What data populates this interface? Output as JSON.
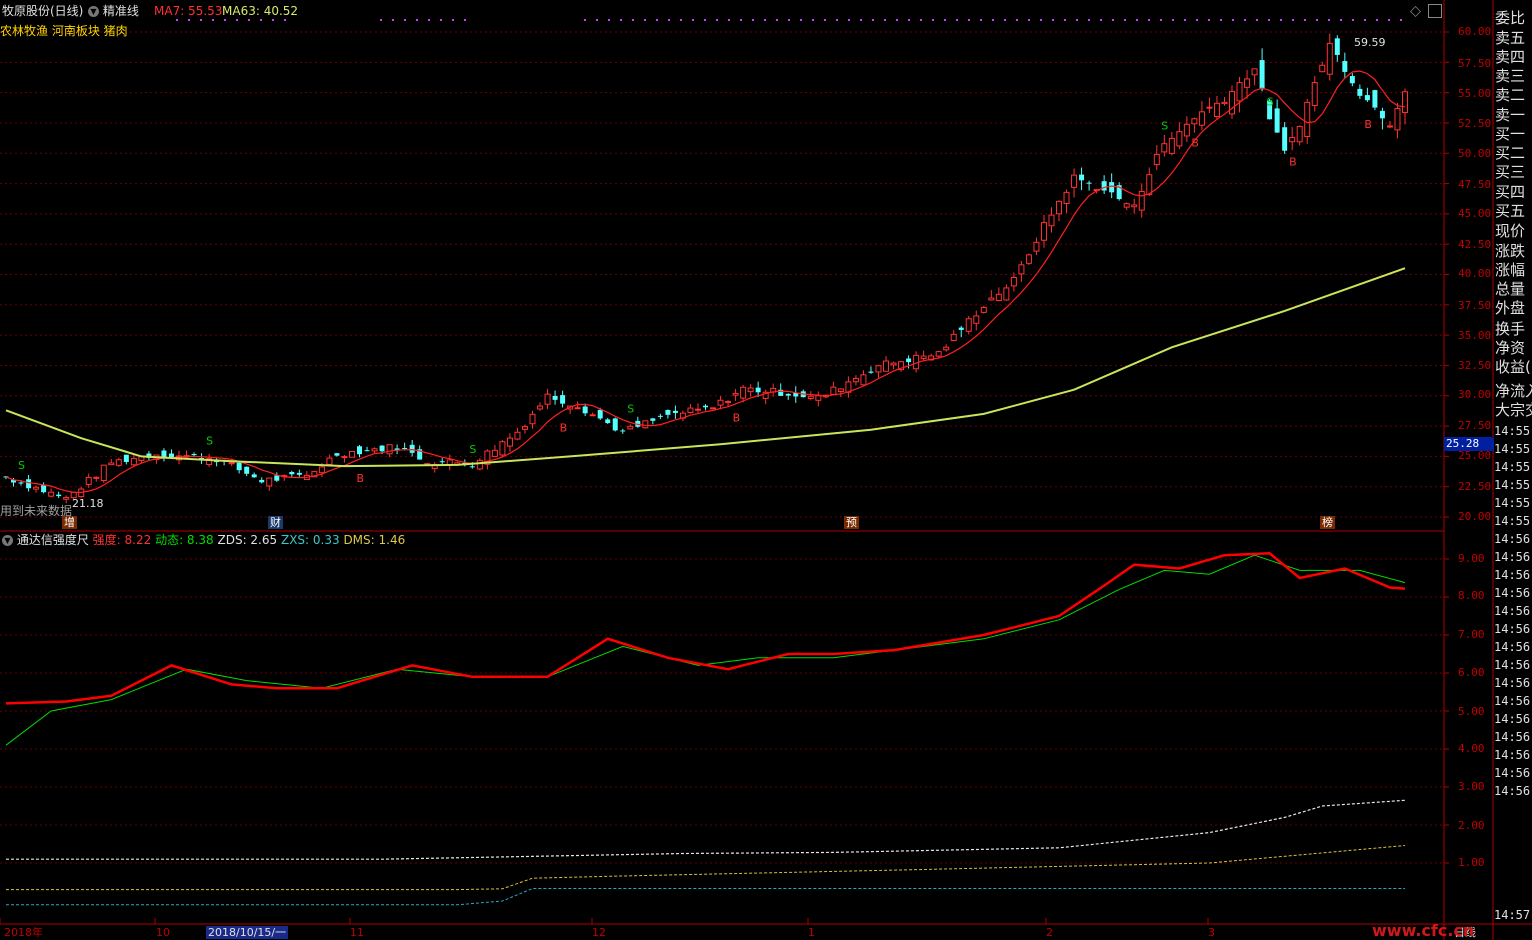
{
  "main_panel": {
    "title": "牧原股份(日线)",
    "indicator_name": "精准线",
    "ma7_label": "MA7: 55.53",
    "ma63_label": "MA63: 40.52",
    "tags": "农林牧渔 河南板块 猪肉",
    "high_label": "59.59",
    "low_label": "21.18",
    "warning": "用到未来数据",
    "signal_buy": "B",
    "signal_sell": "S",
    "y_ticks": [
      "60.00",
      "57.50",
      "55.00",
      "52.50",
      "50.00",
      "47.50",
      "45.00",
      "42.50",
      "40.00",
      "37.50",
      "35.00",
      "32.50",
      "30.00",
      "27.50",
      "25.00",
      "22.50",
      "20.00"
    ],
    "current_price": "25.28",
    "markers": [
      "增",
      "财",
      "预",
      "榜"
    ]
  },
  "sub_panel": {
    "title": "通达信强度尺",
    "strength": "强度: 8.22",
    "dynamic": "动态: 8.38",
    "zds": "ZDS: 2.65",
    "zxs": "ZXS: 0.33",
    "dms": "DMS: 1.46",
    "y_ticks": [
      "9.00",
      "8.00",
      "7.00",
      "6.00",
      "5.00",
      "4.00",
      "3.00",
      "2.00",
      "1.00"
    ]
  },
  "x_axis": {
    "labels": [
      "2018年",
      "10",
      "11",
      "12",
      "1",
      "2",
      "3"
    ],
    "cursor_date": "2018/10/15/一",
    "mode_label": "日线"
  },
  "side_panel": {
    "items": [
      "委比",
      "卖五",
      "卖四",
      "卖三",
      "卖二",
      "卖一",
      "买一",
      "买二",
      "买三",
      "买四",
      "买五",
      "现价",
      "涨跌",
      "涨幅",
      "总量",
      "外盘",
      "换手",
      "净资",
      "收益(",
      "净流入",
      "大宗交"
    ],
    "times": [
      "14:55",
      "14:55",
      "14:55",
      "14:55",
      "14:55",
      "14:55",
      "14:56",
      "14:56",
      "14:56",
      "14:56",
      "14:56",
      "14:56",
      "14:56",
      "14:56",
      "14:56",
      "14:56",
      "14:56",
      "14:56",
      "14:56",
      "14:56",
      "14:56",
      "14:57"
    ]
  },
  "watermark": "www.cfc.cn",
  "colors": {
    "up": "#ff3232",
    "down": "#54ffff",
    "ma_short": "#ff2020",
    "ma_long": "#c8e65a",
    "strength_line": "#ff0000",
    "dynamic_line": "#00dd00",
    "grid": "#8b0000",
    "limit_up": "#ffa500"
  },
  "chart_data": {
    "type": "candlestick",
    "title": "牧原股份(日线)",
    "ma7_last": 55.53,
    "ma63_last": 40.52,
    "period_high": 59.59,
    "period_low": 21.18,
    "ylim": [
      20,
      60
    ],
    "strength_last": 8.22,
    "dynamic_last": 8.38,
    "zds_last": 2.65,
    "zxs_last": 0.33,
    "dms_last": 1.46
  }
}
